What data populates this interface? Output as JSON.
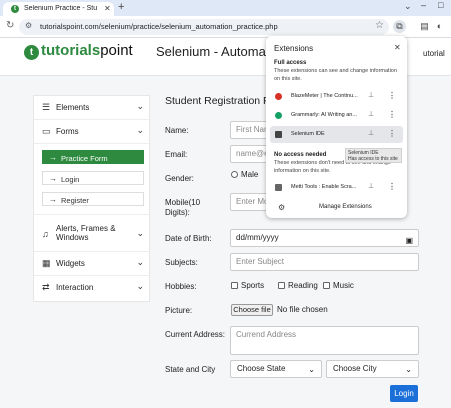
{
  "browser": {
    "tab_title": "Selenium Practice - Student R",
    "tab_favicon": "tp-icon",
    "url": "tutorialspoint.com/selenium/practice/selenium_automation_practice.php"
  },
  "site": {
    "logo_bold": "tutorials",
    "logo_light": "point",
    "page_heading": "Selenium - Automation",
    "header_right": "utorial"
  },
  "sidebar": {
    "items": [
      {
        "icon": "hamburger-icon",
        "label": "Elements"
      },
      {
        "icon": "form-icon",
        "label": "Forms"
      },
      {
        "icon": "bell-icon",
        "label": "Alerts, Frames &\nWindows"
      },
      {
        "icon": "grid-icon",
        "label": "Widgets"
      },
      {
        "icon": "swap-icon",
        "label": "Interaction"
      }
    ],
    "forms_sub": [
      {
        "label": "Practice Form",
        "active": true
      },
      {
        "label": "Login",
        "active": false
      },
      {
        "label": "Register",
        "active": false
      }
    ]
  },
  "form": {
    "title": "Student Registration Fo",
    "name_label": "Name:",
    "name_placeholder": "First Nam",
    "email_label": "Email:",
    "email_placeholder": "name@e",
    "gender_label": "Gender:",
    "gender_option_male": "Male",
    "mobile_label": "Mobile(10\nDigits):",
    "mobile_placeholder": "Enter Mo",
    "dob_label": "Date of Birth:",
    "dob_value": "dd/mm/yyyy",
    "subjects_label": "Subjects:",
    "subjects_placeholder": "Enter Subject",
    "hobbies_label": "Hobbies:",
    "hobby_sports": "Sports",
    "hobby_reading": "Reading",
    "hobby_music": "Music",
    "picture_label": "Picture:",
    "choose_file": "Choose file",
    "no_file": "No file chosen",
    "address_label": "Current Address:",
    "address_placeholder": "Currend Address",
    "state_city_label": "State and City",
    "state_select": "Choose State",
    "city_select": "Choose City",
    "login_button": "Login"
  },
  "extensions": {
    "title": "Extensions",
    "full_access_heading": "Full access",
    "full_access_desc": "These extensions can see and change information on this site.",
    "full_access_items": [
      {
        "name": "BlazeMeter | The Continu...",
        "color": "#d93025"
      },
      {
        "name": "Grammarly: AI Writing an...",
        "color": "#15a066"
      },
      {
        "name": "Selenium IDE",
        "color": "#444444"
      }
    ],
    "no_access_heading": "No access needed",
    "no_access_desc": "These extensions don't need to see and change information on this site.",
    "no_access_items": [
      {
        "name": "Metti Tools : Enable Scra...",
        "color": "#666666"
      }
    ],
    "manage_label": "Manage Extensions",
    "tooltip_title": "Selenium IDE",
    "tooltip_text": "Has access to this site"
  }
}
